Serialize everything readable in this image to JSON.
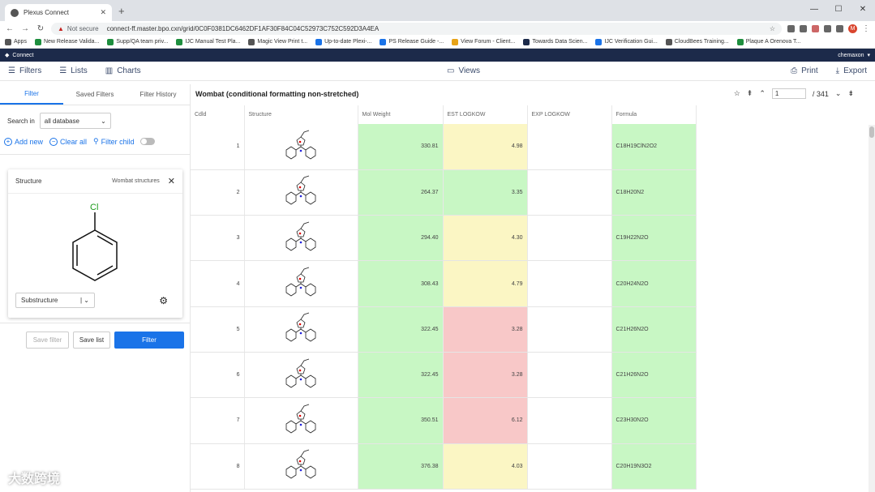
{
  "browser": {
    "tab_title": "Plexus Connect",
    "security_label": "Not secure",
    "url": "connect-ff.master.bpo.cxn/grid/0C0F0381DC6462DF1AF30F84C04C52973C752C592D3A4EA",
    "avatar_letter": "M",
    "bookmarks": [
      "Apps",
      "New Release Valida...",
      "Supp/QA team priv...",
      "IJC Manual Test Pla...",
      "Magic View Print t...",
      "Up-to-date Plexi-...",
      "PS Release Guide -...",
      "View Forum - Client...",
      "Towards Data Scien...",
      "IJC Verification Gui...",
      "CloudBees Training...",
      "Plaque A Orenova T..."
    ]
  },
  "app": {
    "name": "Connect",
    "user": "chemaxon",
    "toolbar": {
      "filters": "Filters",
      "lists": "Lists",
      "charts": "Charts",
      "views": "Views",
      "print": "Print",
      "export": "Export"
    }
  },
  "left_panel": {
    "tabs": [
      "Filter",
      "Saved Filters",
      "Filter History"
    ],
    "search_in_label": "Search in",
    "search_in_value": "all database",
    "add_new": "Add new",
    "clear_all": "Clear all",
    "filter_child": "Filter child",
    "structure_card": {
      "title": "Structure",
      "source": "Wombat structures",
      "atom_label": "Cl",
      "mode": "Substructure"
    },
    "buttons": {
      "save_filter": "Save filter",
      "save_list": "Save list",
      "filter": "Filter"
    }
  },
  "grid": {
    "title": "Wombat (conditional formatting non-stretched)",
    "page": "1",
    "page_total": "/ 341",
    "columns": [
      "Cdld",
      "Structure",
      "Mol Weight",
      "EST LOGKOW",
      "EXP LOGKOW",
      "Formula"
    ],
    "rows": [
      {
        "id": "1",
        "mw": "330.81",
        "est": "4.98",
        "exp": "",
        "formula": "C18H19ClN2O2",
        "mw_color": "g",
        "est_color": "y",
        "f_color": "g"
      },
      {
        "id": "2",
        "mw": "264.37",
        "est": "3.35",
        "exp": "",
        "formula": "C18H20N2",
        "mw_color": "g",
        "est_color": "g",
        "f_color": "g"
      },
      {
        "id": "3",
        "mw": "294.40",
        "est": "4.30",
        "exp": "",
        "formula": "C19H22N2O",
        "mw_color": "g",
        "est_color": "y",
        "f_color": "g"
      },
      {
        "id": "4",
        "mw": "308.43",
        "est": "4.79",
        "exp": "",
        "formula": "C20H24N2O",
        "mw_color": "g",
        "est_color": "y",
        "f_color": "g"
      },
      {
        "id": "5",
        "mw": "322.45",
        "est": "3.28",
        "exp": "",
        "formula": "C21H26N2O",
        "mw_color": "g",
        "est_color": "r",
        "f_color": "g"
      },
      {
        "id": "6",
        "mw": "322.45",
        "est": "3.28",
        "exp": "",
        "formula": "C21H26N2O",
        "mw_color": "g",
        "est_color": "r",
        "f_color": "g"
      },
      {
        "id": "7",
        "mw": "350.51",
        "est": "6.12",
        "exp": "",
        "formula": "C23H30N2O",
        "mw_color": "g",
        "est_color": "r",
        "f_color": "g"
      },
      {
        "id": "8",
        "mw": "376.38",
        "est": "4.03",
        "exp": "",
        "formula": "C20H19N3O2",
        "mw_color": "g",
        "est_color": "y",
        "f_color": "g"
      }
    ]
  },
  "watermark": "大数跨境"
}
